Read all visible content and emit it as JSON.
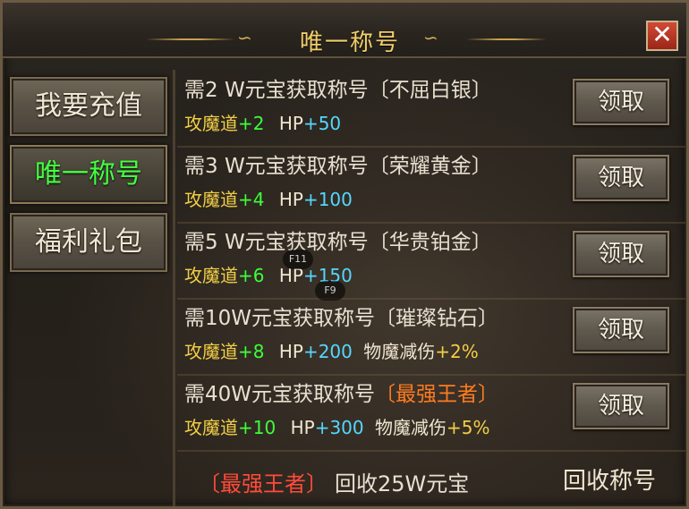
{
  "window": {
    "title": "唯一称号",
    "close_label": "✕",
    "ornament_left": "∽",
    "ornament_right": "∽"
  },
  "sidebar": {
    "items": [
      {
        "label": "我要充值",
        "active": false
      },
      {
        "label": "唯一称号",
        "active": true
      },
      {
        "label": "福利礼包",
        "active": false
      }
    ]
  },
  "titles": [
    {
      "requirement": "需2 W元宝获取称号",
      "name": "〔不屈白银〕",
      "stat_name": "攻魔道",
      "stat_value": "+2",
      "hp_label": "HP",
      "hp_value": "+50",
      "extra_name": "",
      "extra_value": "",
      "button": "领取"
    },
    {
      "requirement": "需3 W元宝获取称号",
      "name": "〔荣耀黄金〕",
      "stat_name": "攻魔道",
      "stat_value": "+4",
      "hp_label": "HP",
      "hp_value": "+100",
      "extra_name": "",
      "extra_value": "",
      "button": "领取"
    },
    {
      "requirement": "需5 W元宝获取称号",
      "name": "〔华贵铂金〕",
      "stat_name": "攻魔道",
      "stat_value": "+6",
      "hp_label": "HP",
      "hp_value": "+150",
      "extra_name": "",
      "extra_value": "",
      "button": "领取"
    },
    {
      "requirement": "需10W元宝获取称号",
      "name": "〔璀璨钻石〕",
      "stat_name": "攻魔道",
      "stat_value": "+8",
      "hp_label": "HP",
      "hp_value": "+200",
      "extra_name": "物魔减伤",
      "extra_value": "+2%",
      "button": "领取"
    },
    {
      "requirement": "需40W元宝获取称号",
      "name": "〔最强王者〕",
      "stat_name": "攻魔道",
      "stat_value": "+10",
      "hp_label": "HP",
      "hp_value": "+300",
      "extra_name": "物魔减伤",
      "extra_value": "+5%",
      "button": "领取"
    }
  ],
  "footer": {
    "title_name": "〔最强王者〕",
    "recycle_text": "回收25W元宝",
    "recycle_button": "回收称号"
  },
  "hotkeys": [
    "F11",
    "F9"
  ],
  "colors": {
    "title_gold": "#f2cf6a",
    "active_green": "#43ff41",
    "stat_yellow": "#f2cf46",
    "value_green": "#3cff3a",
    "value_cyan": "#55d7ff",
    "highlight_orange": "#ff7b1f",
    "footer_red": "#ff4b3a",
    "close_red": "#c23a28"
  }
}
